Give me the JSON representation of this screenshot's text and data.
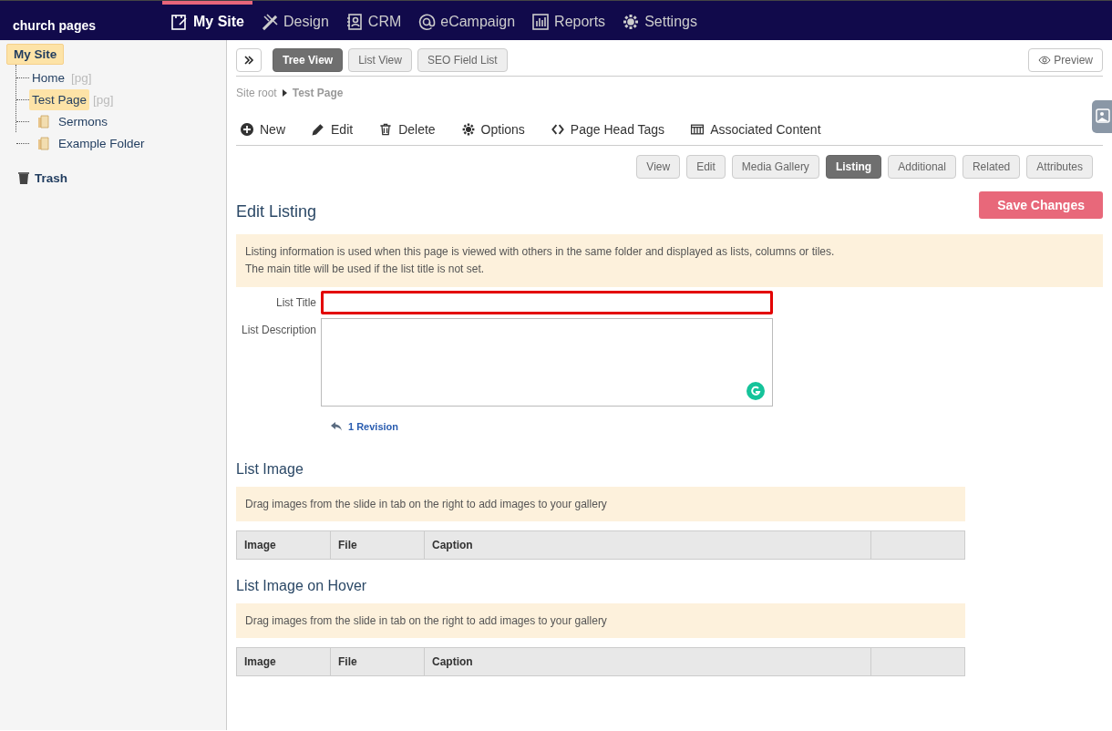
{
  "brand": "church pages",
  "nav": [
    {
      "label": "My Site",
      "selected": true
    },
    {
      "label": "Design",
      "selected": false
    },
    {
      "label": "CRM",
      "selected": false
    },
    {
      "label": "eCampaign",
      "selected": false
    },
    {
      "label": "Reports",
      "selected": false
    },
    {
      "label": "Settings",
      "selected": false
    }
  ],
  "tree": {
    "label": "My Site",
    "selected": true,
    "children": [
      {
        "label": "Home",
        "tag": "[pg]",
        "kind": "page",
        "selected": false
      },
      {
        "label": "Test Page",
        "tag": "[pg]",
        "kind": "page",
        "selected": true
      },
      {
        "label": "Sermons",
        "kind": "folder",
        "selected": false
      },
      {
        "label": "Example Folder",
        "kind": "folder",
        "selected": false
      }
    ]
  },
  "trash": "Trash",
  "view_tabs": [
    {
      "label": "Tree View",
      "selected": true
    },
    {
      "label": "List View",
      "selected": false
    },
    {
      "label": "SEO Field List",
      "selected": false
    }
  ],
  "preview": "Preview",
  "breadcrumb": [
    "Site root",
    "Test Page"
  ],
  "toolbar": [
    {
      "label": "New"
    },
    {
      "label": "Edit"
    },
    {
      "label": "Delete"
    },
    {
      "label": "Options"
    },
    {
      "label": "Page Head Tags"
    },
    {
      "label": "Associated Content"
    }
  ],
  "sub_tabs": [
    {
      "label": "View",
      "selected": false
    },
    {
      "label": "Edit",
      "selected": false
    },
    {
      "label": "Media Gallery",
      "selected": false
    },
    {
      "label": "Listing",
      "selected": true
    },
    {
      "label": "Additional",
      "selected": false
    },
    {
      "label": "Related",
      "selected": false
    },
    {
      "label": "Attributes",
      "selected": false
    }
  ],
  "form": {
    "title": "Edit Listing",
    "save": "Save Changes",
    "notice": [
      "Listing information is used when this page is viewed with others in the same folder and displayed as lists, columns or tiles.",
      "The main title will be used if the list title is not set."
    ],
    "fields": [
      {
        "label": "List Title",
        "kind": "input",
        "highlighted": true
      },
      {
        "label": "List Description",
        "kind": "textarea",
        "highlighted": false
      }
    ],
    "revision": "1 Revision"
  },
  "sections": [
    {
      "title": "List Image",
      "notice": "Drag images from the slide in tab on the right to add images to your gallery",
      "columns": [
        "Image",
        "File",
        "Caption"
      ]
    },
    {
      "title": "List Image on Hover",
      "notice": "Drag images from the slide in tab on the right to add images to your gallery",
      "columns": [
        "Image",
        "File",
        "Caption"
      ]
    }
  ]
}
